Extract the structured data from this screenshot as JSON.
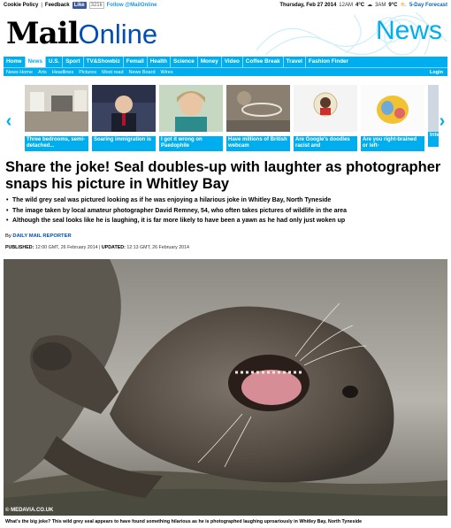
{
  "util": {
    "cookie": "Cookie Policy",
    "sep": "|",
    "feedback": "Feedback",
    "like": "Like",
    "like_count": "321k",
    "follow": "Follow @MailOnline",
    "date": "Thursday, Feb 27 2014",
    "time": "12AM",
    "temp_now": "4°C",
    "time2": "3AM",
    "temp_later": "9°C",
    "forecast": "5-Day Forecast"
  },
  "masthead": {
    "logo_mail": "Mail",
    "logo_online": "Online",
    "section": "News"
  },
  "nav": [
    "Home",
    "News",
    "U.S.",
    "Sport",
    "TV&Showbiz",
    "Femail",
    "Health",
    "Science",
    "Money",
    "Video",
    "Coffee Break",
    "Travel",
    "Fashion Finder"
  ],
  "subnav": {
    "items": [
      "News Home",
      "Arts",
      "Headlines",
      "Pictures",
      "Most read",
      "News Board",
      "Wires"
    ],
    "login": "Login"
  },
  "carousel": [
    {
      "caption": "Three bedrooms, semi-detached..."
    },
    {
      "caption": "Soaring immigration is"
    },
    {
      "caption": "I got it wrong on Paedophile"
    },
    {
      "caption": "Have millions of British webcam"
    },
    {
      "caption": "Are Google's doodles racist and"
    },
    {
      "caption": "Are you right-brained or left-"
    },
    {
      "caption": "Inter"
    }
  ],
  "article": {
    "headline": "Share the joke! Seal doubles-up with laughter as photographer snaps his picture in Whitley Bay",
    "bullets": [
      "The wild grey seal was pictured looking as if he was enjoying a hilarious joke in Whitley Bay, North Tyneside",
      "The image taken by local amateur photographer David Remney, 54, who often takes pictures of wildlife in the area",
      "Although the seal looks like he is laughing, it is far more likely to have been a yawn as he had only just woken up"
    ],
    "byline_prefix": "By",
    "byline": "DAILY MAIL REPORTER",
    "published_label": "PUBLISHED:",
    "published": "12:00 GMT, 26 February 2014",
    "updated_label": "UPDATED:",
    "updated": "12:13 GMT, 26 February 2014",
    "photo_credit": "© MEDAVIA.CO.UK",
    "caption": "What's the big joke? This wild grey seal appears to have found something hilarious as he is photographed laughing uproariously in Whitley Bay, North Tyneside"
  },
  "colors": {
    "accent": "#00aeef",
    "brand_blue": "#004db3",
    "facebook": "#3b5998"
  }
}
